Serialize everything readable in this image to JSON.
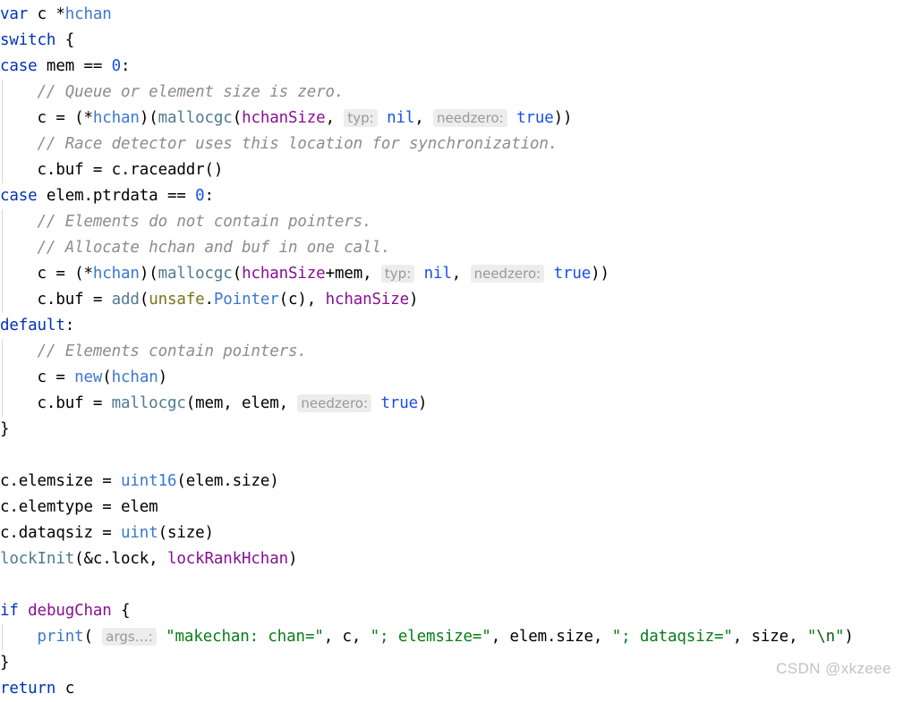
{
  "editor": {
    "language": "go",
    "theme": "light",
    "font_size_px": 17.5,
    "line_height_px": 29,
    "colors": {
      "background": "#ffffff",
      "foreground": "#000000",
      "keyword": "#0033b3",
      "type": "#3b77d1",
      "number": "#1750eb",
      "constant": "#871094",
      "function": "#4f7a90",
      "package": "#7a7320",
      "string": "#067d17",
      "comment": "#8c8c8c",
      "hint_background": "#ededed",
      "hint_foreground": "#999999",
      "indent_guide": "#d8d8dc",
      "watermark": "#c2c2c2"
    }
  },
  "lines": {
    "l1": {
      "kw": "var",
      "sp1": " ",
      "name": "c",
      "sp2": " ",
      "star": "*",
      "type": "hchan"
    },
    "l2": {
      "kw": "switch",
      "rest": " {"
    },
    "l3": {
      "kw": "case",
      "mid": " mem == ",
      "num": "0",
      "colon": ":"
    },
    "l4": {
      "comment": "// Queue or element size is zero."
    },
    "l5": {
      "pre": "c = (*",
      "type1": "hchan",
      "mid1": ")(",
      "fn": "mallocgc",
      "mid2": "(",
      "const1": "hchanSize",
      "comma1": ", ",
      "hint1": "typ:",
      "val1": "nil",
      "comma2": ", ",
      "hint2": "needzero:",
      "val2": "true",
      "tail": "))"
    },
    "l6": {
      "comment": "// Race detector uses this location for synchronization."
    },
    "l7": {
      "text": "c.buf = c.raceaddr()"
    },
    "l8": {
      "kw": "case",
      "mid": " elem.ptrdata == ",
      "num": "0",
      "colon": ":"
    },
    "l9": {
      "comment": "// Elements do not contain pointers."
    },
    "l10": {
      "comment": "// Allocate hchan and buf in one call."
    },
    "l11": {
      "pre": "c = (*",
      "type1": "hchan",
      "mid1": ")(",
      "fn": "mallocgc",
      "mid2": "(",
      "const1": "hchanSize",
      "plus": "+mem",
      "comma1": ", ",
      "hint1": "typ:",
      "val1": "nil",
      "comma2": ", ",
      "hint2": "needzero:",
      "val2": "true",
      "tail": "))"
    },
    "l12": {
      "pre": "c.buf = ",
      "fn": "add",
      "p1": "(",
      "pkg": "unsafe",
      "dot": ".",
      "type1": "Pointer",
      "p2": "(c), ",
      "const1": "hchanSize",
      "tail": ")"
    },
    "l13": {
      "kw": "default",
      "colon": ":"
    },
    "l14": {
      "comment": "// Elements contain pointers."
    },
    "l15": {
      "pre": "c = ",
      "fn": "new",
      "p1": "(",
      "type1": "hchan",
      "tail": ")"
    },
    "l16": {
      "pre": "c.buf = ",
      "fn": "mallocgc",
      "mid": "(mem, elem, ",
      "hint": "needzero:",
      "val": "true",
      "tail": ")"
    },
    "l17": {
      "text": "}"
    },
    "l18": {
      "text": ""
    },
    "l19": {
      "pre": "c.elemsize = ",
      "type1": "uint16",
      "tail": "(elem.size)"
    },
    "l20": {
      "text": "c.elemtype = elem"
    },
    "l21": {
      "pre": "c.dataqsiz = ",
      "type1": "uint",
      "tail": "(size)"
    },
    "l22": {
      "fn": "lockInit",
      "mid": "(&c.lock, ",
      "const1": "lockRankHchan",
      "tail": ")"
    },
    "l23": {
      "text": ""
    },
    "l24": {
      "kw": "if",
      "sp": " ",
      "const1": "debugChan",
      "tail": " {"
    },
    "l25": {
      "fn": "print",
      "open": "( ",
      "hint": "args…:",
      "sp": " ",
      "str1": "\"makechan: chan=\"",
      "mid1": ", c, ",
      "str2": "\"; elemsize=\"",
      "mid2": ", elem.size, ",
      "str3": "\"; dataqsiz=\"",
      "mid3": ", size, ",
      "quote_open": "\"",
      "esc": "\\n",
      "quote_close": "\"",
      "tail": ")"
    },
    "l26": {
      "text": "}"
    },
    "l27": {
      "kw": "return",
      "rest": " c"
    }
  },
  "watermark": {
    "text": "CSDN @xkzeee"
  }
}
